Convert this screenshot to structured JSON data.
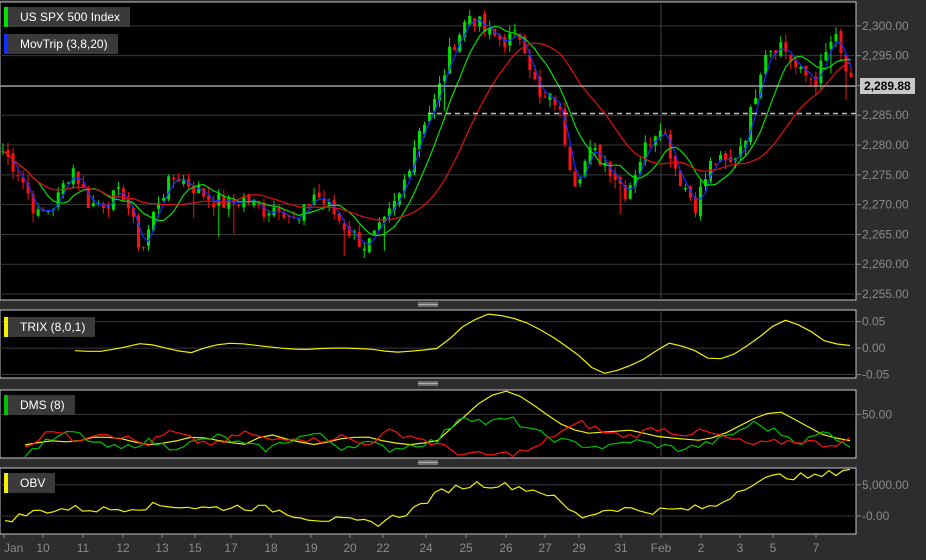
{
  "panels": {
    "price": {
      "legend": [
        {
          "label": "US SPX 500 Index",
          "color": "#00e000"
        },
        {
          "label": "MovTrip (3,8,20)",
          "color": "#1030ff"
        }
      ],
      "last_price": "2,289.88",
      "yticks": [
        "2,300.00",
        "2,295.00",
        "2,290.00",
        "2,285.00",
        "2,280.00",
        "2,275.00",
        "2,270.00",
        "2,265.00",
        "2,260.00",
        "2,255.00"
      ]
    },
    "trix": {
      "label": "TRIX (8,0,1)",
      "color": "#f0f000",
      "yticks": [
        "0.05",
        "0.00",
        "-0.05"
      ]
    },
    "dms": {
      "label": "DMS (8)",
      "color": "#00c000",
      "yticks": [
        "50.00"
      ]
    },
    "obv": {
      "label": "OBV",
      "color": "#f0f000",
      "yticks": [
        "5,000.00",
        "-0.00"
      ]
    }
  },
  "xaxis": {
    "labels": [
      "Jan",
      "10",
      "11",
      "12",
      "13",
      "15",
      "17",
      "18",
      "19",
      "20",
      "22",
      "24",
      "25",
      "26",
      "27",
      "29",
      "31",
      "Feb",
      "2",
      "3",
      "5",
      "7"
    ]
  },
  "chart_data": {
    "type": "candlestick",
    "ylim": [
      2254,
      2304
    ],
    "reference_line": 2285.3,
    "closes": [
      2279,
      2275,
      2268,
      2270,
      2276.5,
      2270,
      2270.5,
      2272,
      2262,
      2271,
      2275,
      2273,
      2271,
      2270,
      2271,
      2269,
      2270,
      2266.5,
      2272,
      2269,
      2265.5,
      2263,
      2266.5,
      2272,
      2282.5,
      2287.5,
      2297,
      2302,
      2298.5,
      2297.5,
      2298.5,
      2287.5,
      2287.5,
      2274,
      2279,
      2276.5,
      2272,
      2279,
      2284,
      2275,
      2270,
      2277.5,
      2276.5,
      2282.5,
      2296,
      2297,
      2292,
      2291,
      2298.5,
      2290
    ],
    "moving_averages": [
      {
        "period": 3,
        "color": "#1030ff"
      },
      {
        "period": 8,
        "color": "#00e000"
      },
      {
        "period": 20,
        "color": "#e01010"
      }
    ],
    "up_color": "#00e000",
    "down_color": "#ff1010",
    "trix": {
      "ylim": [
        -0.05,
        0.05
      ],
      "values": [
        -0.005,
        -0.007,
        0.0,
        0.01,
        0.0,
        -0.01,
        0.005,
        0.01,
        0.005,
        0.0,
        -0.003,
        0.0,
        0.0,
        -0.002,
        -0.008,
        -0.005,
        0.0,
        0.04,
        0.065,
        0.06,
        0.045,
        0.02,
        -0.01,
        -0.05,
        -0.04,
        -0.02,
        0.01,
        0.0,
        -0.025,
        -0.01,
        0.02,
        0.055,
        0.04,
        0.01,
        0.005
      ]
    },
    "dms": {
      "ylim": [
        0,
        78
      ],
      "series": [
        {
          "color": "#f0f000",
          "values": [
            15,
            20,
            18,
            25,
            22,
            15,
            18,
            25,
            20,
            15,
            28,
            20,
            15,
            22,
            25,
            18,
            15,
            20,
            45,
            70,
            78,
            60,
            40,
            28,
            30,
            32,
            25,
            22,
            20,
            30,
            45,
            55,
            40,
            25,
            20
          ]
        },
        {
          "color": "#00c000",
          "values": [
            5,
            20,
            30,
            15,
            10,
            20,
            12,
            18,
            25,
            15,
            10,
            22,
            28,
            12,
            18,
            10,
            15,
            20,
            50,
            40,
            45,
            30,
            20,
            15,
            12,
            20,
            15,
            10,
            15,
            25,
            40,
            30,
            18,
            30,
            15
          ]
        },
        {
          "color": "#ff1010",
          "values": [
            10,
            35,
            20,
            30,
            25,
            15,
            30,
            20,
            15,
            30,
            20,
            25,
            20,
            25,
            15,
            30,
            25,
            15,
            5,
            3,
            5,
            10,
            30,
            40,
            28,
            25,
            35,
            28,
            30,
            22,
            15,
            18,
            20,
            15,
            20
          ]
        }
      ]
    },
    "obv": {
      "ylim": [
        -2900,
        7700
      ],
      "values": [
        -650,
        800,
        1200,
        1000,
        1500,
        1700,
        1200,
        1500,
        1000,
        -300,
        -800,
        -1200,
        800,
        4200,
        5200,
        4800,
        3800,
        -200,
        1300,
        800,
        1000,
        1500,
        5200,
        6500,
        6200,
        7700
      ]
    }
  }
}
